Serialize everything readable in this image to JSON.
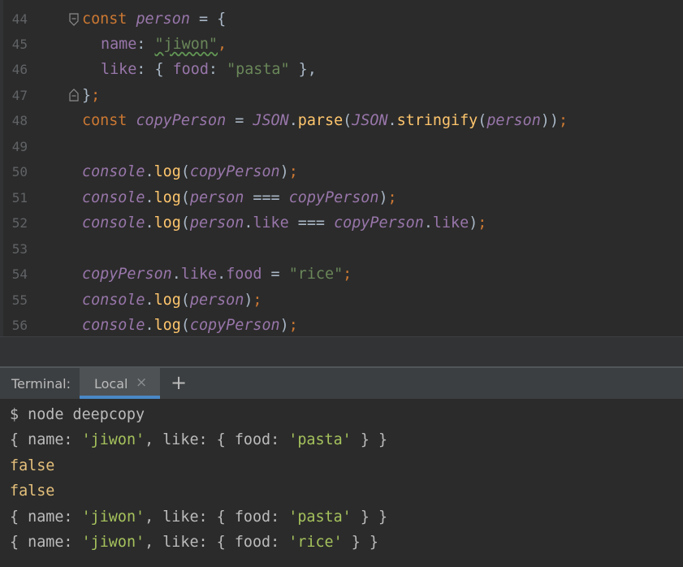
{
  "editor": {
    "line_numbers": [
      "44",
      "45",
      "46",
      "47",
      "48",
      "49",
      "50",
      "51",
      "52",
      "53",
      "54",
      "55",
      "56"
    ],
    "tokens": {
      "const": "const",
      "person": "person",
      "eq": " = ",
      "open_brace": "{",
      "name_key": "name",
      "colon": ": ",
      "jiwon_str": "\"jiwon\"",
      "comma": ",",
      "like_key": "like",
      "like_open": "{ ",
      "food_key": "food",
      "pasta_str": "\"pasta\"",
      "like_close": " },",
      "close_brace": "}",
      "semicolon": ";",
      "copyPerson": "copyPerson",
      "JSON": "JSON",
      "dot": ".",
      "parse": "parse",
      "stringify": "stringify",
      "lparen": "(",
      "rparen": ")",
      "rparen2": "))",
      "console": "console",
      "log": "log",
      "strict_eq": " === ",
      "like_prop": "like",
      "food_prop": "food",
      "rice_str": "\"rice\""
    }
  },
  "terminal": {
    "tab_title": "Terminal:",
    "tab_local": "Local",
    "close_glyph": "×",
    "add_glyph": "+",
    "prompt": "$ node deepcopy",
    "obj_open": "{ name: ",
    "obj_mid": ", like: { food: ",
    "obj_close": " } }",
    "jiwon": "'jiwon'",
    "pasta": "'pasta'",
    "rice": "'rice'",
    "false_value": "false"
  },
  "colors": {
    "editor_bg": "#2b2b2b",
    "keyword": "#cc7832",
    "variable": "#9876aa",
    "string": "#6a8759",
    "function": "#ffc66d",
    "tab_accent": "#4a88c7"
  }
}
